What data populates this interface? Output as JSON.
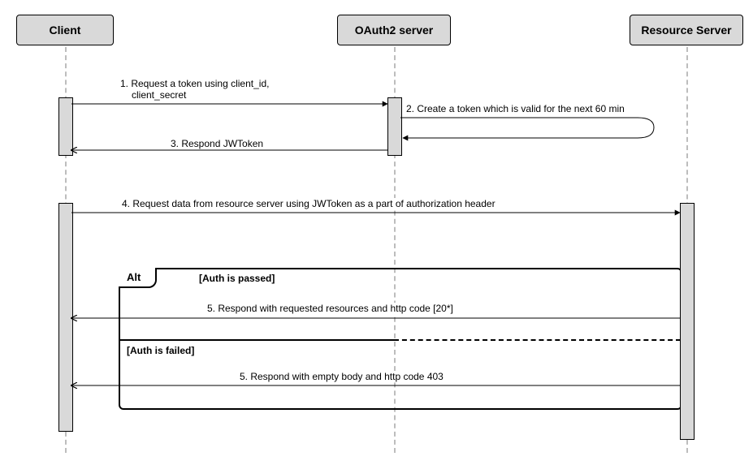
{
  "participants": {
    "client": "Client",
    "oauth": "OAuth2 server",
    "resource": "Resource Server"
  },
  "messages": {
    "m1_line1": "1. Request a token using client_id,",
    "m1_line2": "client_secret",
    "m2": "2. Create a token which is valid for the next 60 min",
    "m3": "3. Respond JWToken",
    "m4": "4. Request data from resource server using JWToken as a part of authorization header",
    "m5a": "5. Respond with requested resources and http code [20*]",
    "m5b": "5. Respond with empty body and http code 403"
  },
  "fragment": {
    "operator": "Alt",
    "guard_pass": "[Auth is passed]",
    "guard_fail": "[Auth is failed]"
  }
}
